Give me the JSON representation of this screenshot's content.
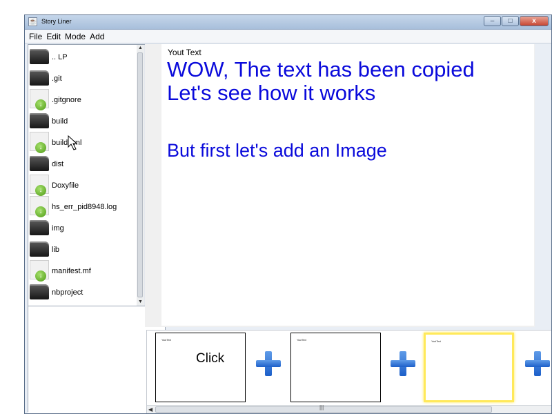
{
  "window": {
    "title": "Story Liner",
    "controls": {
      "minimize": "–",
      "maximize": "□",
      "close": "x"
    }
  },
  "menu": [
    "File",
    "Edit",
    "Mode",
    "Add"
  ],
  "files": [
    {
      "name": ".. LP",
      "type": "folder"
    },
    {
      "name": ".git",
      "type": "folder"
    },
    {
      "name": ".gitgnore",
      "type": "file"
    },
    {
      "name": "build",
      "type": "folder"
    },
    {
      "name": "build.xml",
      "type": "file"
    },
    {
      "name": "dist",
      "type": "folder"
    },
    {
      "name": "Doxyfile",
      "type": "file"
    },
    {
      "name": "hs_err_pid8948.log",
      "type": "file"
    },
    {
      "name": "img",
      "type": "folder"
    },
    {
      "name": "lib",
      "type": "folder"
    },
    {
      "name": "manifest.mf",
      "type": "file"
    },
    {
      "name": "nbproject",
      "type": "folder"
    }
  ],
  "editor": {
    "label": "Yout Text",
    "lines": [
      "WOW, The text has been copied",
      "Let's see how it works",
      "",
      "But first let's add an Image"
    ]
  },
  "slides": [
    {
      "mini_text": "Yout Text",
      "text": "Click",
      "selected": false
    },
    {
      "mini_text": "Yout Text",
      "text": "",
      "selected": false
    },
    {
      "mini_text": "Yout Text",
      "text": "",
      "selected": true
    }
  ],
  "icons": {
    "folder": "folder-icon",
    "file": "file-icon",
    "add": "plus-icon"
  },
  "colors": {
    "editor_text": "#0a0adb",
    "selected_slide": "#ffe95a",
    "plus": "#1c5fc9"
  }
}
